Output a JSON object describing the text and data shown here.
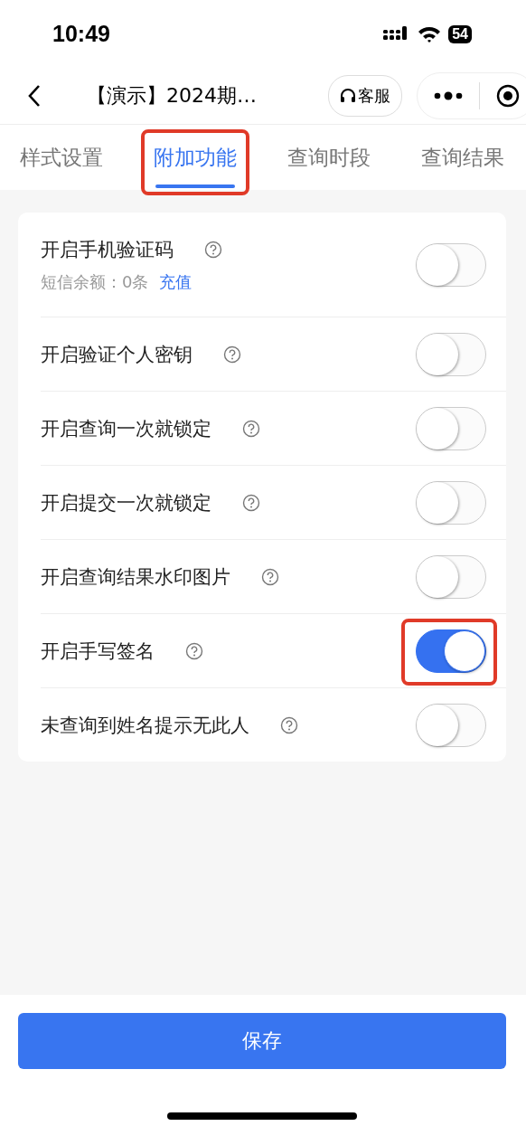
{
  "status_bar": {
    "time": "10:49",
    "battery": "54"
  },
  "nav": {
    "title": "【演示】2024期…",
    "service_button": "客服"
  },
  "tabs": [
    {
      "label": "样式设置",
      "selected": false,
      "highlighted": false
    },
    {
      "label": "附加功能",
      "selected": true,
      "highlighted": true
    },
    {
      "label": "查询时段",
      "selected": false,
      "highlighted": false
    },
    {
      "label": "查询结果",
      "selected": false,
      "highlighted": false
    }
  ],
  "settings": [
    {
      "label": "开启手机验证码",
      "on": false,
      "highlighted": false,
      "note": "短信余额：0条",
      "link": "充值"
    },
    {
      "label": "开启验证个人密钥",
      "on": false,
      "highlighted": false
    },
    {
      "label": "开启查询一次就锁定",
      "on": false,
      "highlighted": false
    },
    {
      "label": "开启提交一次就锁定",
      "on": false,
      "highlighted": false
    },
    {
      "label": "开启查询结果水印图片",
      "on": false,
      "highlighted": false
    },
    {
      "label": "开启手写签名",
      "on": true,
      "highlighted": true
    },
    {
      "label": "未查询到姓名提示无此人",
      "on": false,
      "highlighted": false
    }
  ],
  "save_button": "保存"
}
